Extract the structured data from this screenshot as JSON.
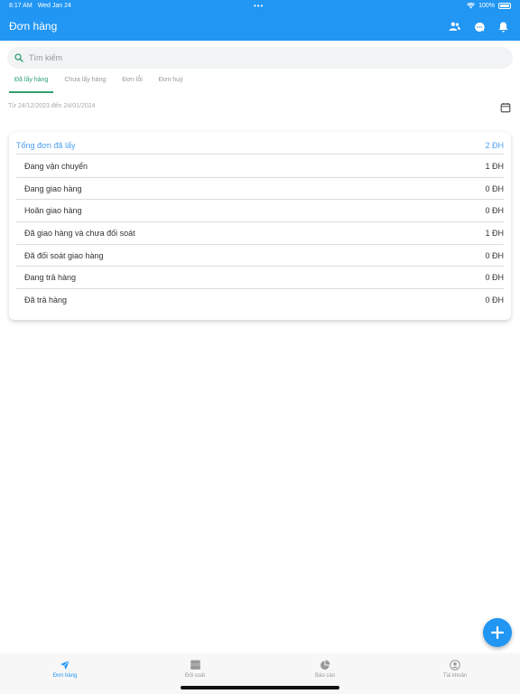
{
  "status_bar": {
    "time": "8:17 AM",
    "date": "Wed Jan 24",
    "battery": "100%"
  },
  "app_bar": {
    "title": "Đơn hàng"
  },
  "search": {
    "placeholder": "Tìm kiếm"
  },
  "tabs": [
    {
      "label": "Đã lấy hàng",
      "active": true
    },
    {
      "label": "Chưa lấy hàng",
      "active": false
    },
    {
      "label": "Đơn lỗi",
      "active": false
    },
    {
      "label": "Đơn huỷ",
      "active": false
    }
  ],
  "date_range": "Từ 24/12/2023 đến 24/01/2024",
  "summary": {
    "header_label": "Tổng đơn đã lấy",
    "header_value": "2 ĐH",
    "rows": [
      {
        "label": "Đang vận chuyển",
        "value": "1 ĐH"
      },
      {
        "label": "Đang giao hàng",
        "value": "0 ĐH"
      },
      {
        "label": "Hoãn giao hàng",
        "value": "0 ĐH"
      },
      {
        "label": "Đã giao hàng và chưa đối soát",
        "value": "1 ĐH"
      },
      {
        "label": "Đã đối soát giao hàng",
        "value": "0 ĐH"
      },
      {
        "label": "Đang trả hàng",
        "value": "0 ĐH"
      },
      {
        "label": "Đã trả hàng",
        "value": "0 ĐH"
      }
    ]
  },
  "bottom_nav": [
    {
      "label": "Đơn hàng",
      "icon": "send-icon",
      "active": true
    },
    {
      "label": "Đối soát",
      "icon": "money-stack-icon",
      "active": false
    },
    {
      "label": "Báo cáo",
      "icon": "pie-chart-icon",
      "active": false
    },
    {
      "label": "Tài khoản",
      "icon": "account-icon",
      "active": false
    }
  ],
  "colors": {
    "primary": "#2196f3",
    "tab_active": "#2e9f6f",
    "summary_header": "#4a9ef0"
  }
}
